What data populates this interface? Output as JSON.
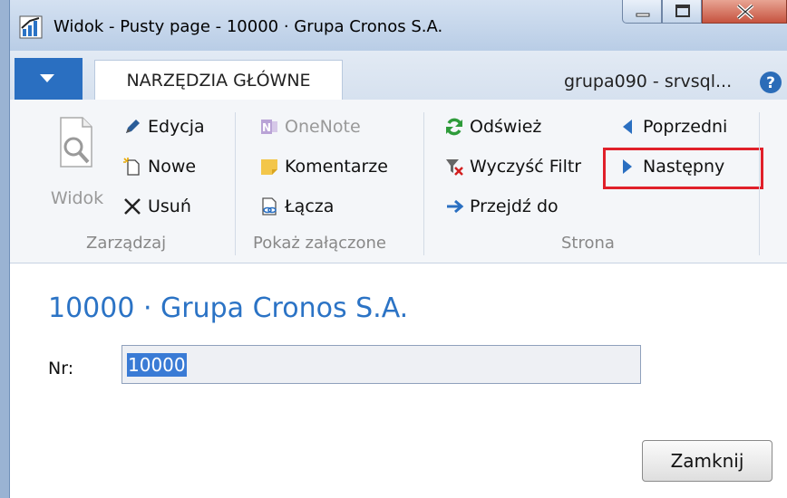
{
  "window": {
    "title": "Widok - Pusty page - 10000 · Grupa Cronos S.A."
  },
  "tabs": {
    "active": "NARZĘDZIA GŁÓWNE",
    "server": "grupa090 - srvsql..."
  },
  "ribbon": {
    "zarzadzaj": {
      "label": "Zarządzaj",
      "widok": "Widok",
      "edycja": "Edycja",
      "nowe": "Nowe",
      "usun": "Usuń"
    },
    "zalaczone": {
      "label": "Pokaż załączone",
      "onenote": "OneNote",
      "komentarze": "Komentarze",
      "lacza": "Łącza"
    },
    "strona": {
      "label": "Strona",
      "odswiez": "Odśwież",
      "wyczysc": "Wyczyść Filtr",
      "przejdz": "Przejdź do",
      "poprzedni": "Poprzedni",
      "nastepny": "Następny"
    }
  },
  "content": {
    "title": "10000 · Grupa Cronos S.A.",
    "nr_label": "Nr:",
    "nr_value": "10000"
  },
  "footer": {
    "close_label": "Zamknij"
  },
  "colors": {
    "accent": "#2b73c5",
    "highlight": "#e0202a",
    "file_button": "#2a6fc1"
  }
}
